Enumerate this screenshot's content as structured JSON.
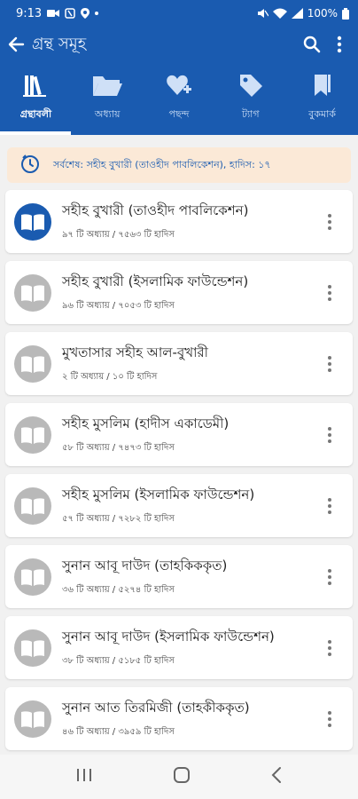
{
  "status_bar": {
    "time": "9:13",
    "battery": "100%"
  },
  "app_bar": {
    "title": "গ্রন্থ সমূহ",
    "icons": [
      "back-arrow-icon",
      "search-icon",
      "more-vert-icon"
    ]
  },
  "tabs": [
    {
      "label": "গ্রন্থাবলী",
      "icon": "books-icon",
      "active": true
    },
    {
      "label": "অধ্যায়",
      "icon": "folder-icon",
      "active": false
    },
    {
      "label": "পছন্দ",
      "icon": "heart-plus-icon",
      "active": false
    },
    {
      "label": "ট্যাগ",
      "icon": "tag-icon",
      "active": false
    },
    {
      "label": "বুকমার্ক",
      "icon": "bookmark-icon",
      "active": false
    }
  ],
  "last_read": {
    "text": "সর্বশেষ: সহীহ বুখারী (তাওহীদ পাবলিকেশন), হাদিস: ১৭"
  },
  "books": [
    {
      "title": "সহীহ বুখারী (তাওহীদ পাবলিকেশন)",
      "meta": "৯৭ টি অধ্যায় / ৭৫৬৩ টি হাদিস",
      "active": true
    },
    {
      "title": "সহীহ বুখারী (ইসলামিক ফাউন্ডেশন)",
      "meta": "৯৬ টি অধ্যায় / ৭০৫৩ টি হাদিস",
      "active": false
    },
    {
      "title": "মুখতাসার সহীহ আল-বুখারী",
      "meta": "২ টি অধ্যায় / ১০ টি হাদিস",
      "active": false
    },
    {
      "title": "সহীহ মুসলিম (হাদীস একাডেমী)",
      "meta": "৫৮ টি অধ্যায় / ৭৪৭৩ টি হাদিস",
      "active": false
    },
    {
      "title": "সহীহ মুসলিম (ইসলামিক ফাউন্ডেশন)",
      "meta": "৫৭ টি অধ্যায় / ৭২৮২ টি হাদিস",
      "active": false
    },
    {
      "title": "সুনান আবূ দাউদ (তাহকিককৃত)",
      "meta": "৩৬ টি অধ্যায় / ৫২৭৪ টি হাদিস",
      "active": false
    },
    {
      "title": "সুনান আবূ দাউদ (ইসলামিক ফাউন্ডেশন)",
      "meta": "৩৮ টি অধ্যায় / ৫১৮৫ টি হাদিস",
      "active": false
    },
    {
      "title": "সুনান আত তিরমিজী (তাহকীককৃত)",
      "meta": "৪৬ টি অধ্যায় / ৩৯৫৯ টি হাদিস",
      "active": false
    }
  ],
  "colors": {
    "primary": "#1a5bb0",
    "banner_bg": "#fbe9d7",
    "avatar_inactive": "#b9b9b9"
  }
}
